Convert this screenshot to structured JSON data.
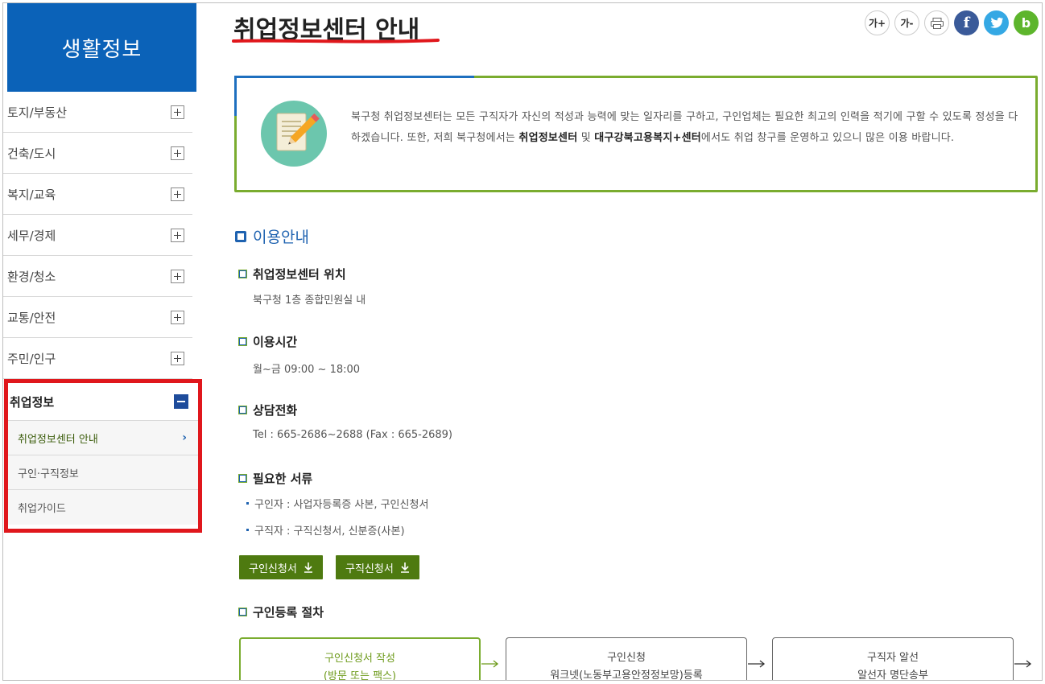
{
  "sidebar": {
    "title": "생활정보",
    "items": [
      {
        "label": "토지/부동산"
      },
      {
        "label": "건축/도시"
      },
      {
        "label": "복지/교육"
      },
      {
        "label": "세무/경제"
      },
      {
        "label": "환경/청소"
      },
      {
        "label": "교통/안전"
      },
      {
        "label": "주민/인구"
      }
    ],
    "active": {
      "label": "취업정보",
      "subitems": [
        {
          "label": "취업정보센터 안내",
          "current": true
        },
        {
          "label": "구인·구직정보"
        },
        {
          "label": "취업가이드"
        }
      ]
    }
  },
  "page": {
    "title": "취업정보센터 안내",
    "tools": {
      "font_up": "가+",
      "font_down": "가-",
      "facebook": "f",
      "blog": "b"
    },
    "intro": {
      "part1": "북구청 취업정보센터는 모든 구직자가 자신의 적성과 능력에 맞는 일자리를 구하고, 구인업체는 필요한 최고의 인력을 적기에 구할 수 있도록 정성을 다하겠습니다. 또한, 저희 북구청에서는 ",
      "bold1": "취업정보센터",
      "part2": "  및  ",
      "bold2": "대구강북고용복지+센터",
      "part3": "에서도 취업 창구를 운영하고 있으니 많은 이용 바랍니다."
    },
    "section": "이용안내",
    "location": {
      "title": "취업정보센터 위치",
      "text": "북구청 1층 종합민원실 내"
    },
    "hours": {
      "title": "이용시간",
      "text": "월~금 09:00 ~ 18:00"
    },
    "phone": {
      "title": "상담전화",
      "text": "Tel : 665-2686~2688 (Fax : 665-2689)"
    },
    "documents": {
      "title": "필요한 서류",
      "items": [
        "구인자 : 사업자등록증 사본, 구인신청서",
        "구직자 : 구직신청서, 신분증(사본)"
      ]
    },
    "buttons": {
      "employer_form": "구인신청서",
      "seeker_form": "구직신청서"
    },
    "procedure": {
      "title": "구인등록 절차",
      "steps": [
        {
          "line1": "구인신청서 작성",
          "line2": "(방문 또는 팩스)"
        },
        {
          "line1": "구인신청",
          "line2": "워크넷(노동부고용안정정보망)등록"
        },
        {
          "line1": "구직자 알선",
          "line2": "알선자 명단송부"
        }
      ]
    }
  }
}
